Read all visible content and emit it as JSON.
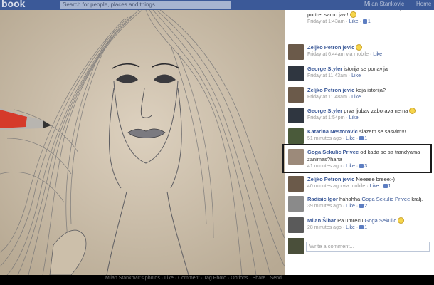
{
  "topbar": {
    "logo": "book",
    "search_text": "Search for people, places and things",
    "user_name": "Milan Stankovic",
    "home_label": "Home"
  },
  "comments": [
    {
      "author": "",
      "text": "christian? a sta ako budes zelela da napravis portret samo javi!",
      "emoji": "smiley",
      "time": "Friday at 1:43am",
      "like_label": "Like",
      "likes": "1"
    },
    {
      "author": "Zeljko Petronijevic",
      "text": "",
      "emoji": "wink",
      "time": "Friday at 6:44am via mobile",
      "like_label": "Like",
      "likes": ""
    },
    {
      "author": "George Styler",
      "text": "istorija se ponavlja",
      "emoji": "",
      "time": "Friday at 11:43am",
      "like_label": "Like",
      "likes": ""
    },
    {
      "author": "Zeljko Petronijevic",
      "text": "koja istorija?",
      "emoji": "",
      "time": "Friday at 11:48am",
      "like_label": "Like",
      "likes": ""
    },
    {
      "author": "George Styler",
      "text": "prva ljubav zaborava nema",
      "emoji": "smiley",
      "time": "Friday at 1:54pm",
      "like_label": "Like",
      "likes": ""
    },
    {
      "author": "Katarina Nestorovic",
      "text": "slazem se sasvim!!!",
      "emoji": "",
      "time": "51 minutes ago",
      "like_label": "Like",
      "likes": "1"
    },
    {
      "author": "Goga Sekulic Privee",
      "text": "od kada se sa trandyama zanimas?haha",
      "emoji": "",
      "time": "41 minutes ago",
      "like_label": "Like",
      "likes": "3"
    },
    {
      "author": "Zeljko Petronijevic",
      "text": "Neeeee breee:-)",
      "emoji": "",
      "time": "40 minutes ago via mobile",
      "like_label": "Like",
      "likes": "1"
    },
    {
      "author": "Radisic Igor",
      "text": "hahahha",
      "tag": "Goga Sekulic Privee",
      "text_after": "kralj.",
      "emoji": "",
      "time": "39 minutes ago",
      "like_label": "Like",
      "likes": "2"
    },
    {
      "author": "Milan Šibar",
      "text": "Pa umrecu",
      "tag": "Goga Sekulic",
      "text_after": "",
      "emoji": "smiley",
      "time": "28 minutes ago",
      "like_label": "Like",
      "likes": "1"
    }
  ],
  "write_comment_placeholder": "Write a comment...",
  "bottombar": {
    "caption": "Milan Stankovic's photos · Like · Comment · Tag Photo · Options · Share · Send"
  },
  "colors": {
    "facebook_blue": "#3b5998",
    "link_blue": "#3b5998",
    "meta_gray": "#999999",
    "paper_beige": "#d5c8b5"
  }
}
